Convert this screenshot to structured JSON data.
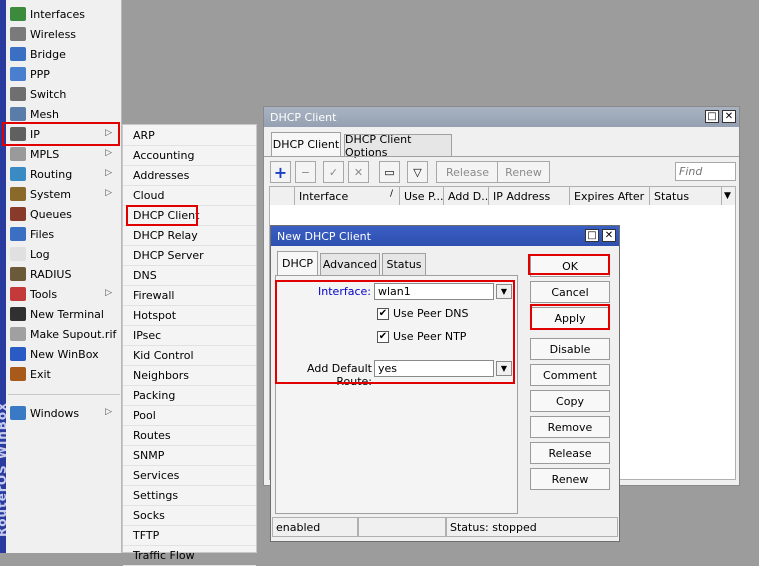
{
  "app": {
    "vertical_label": "RouterOS WinBox"
  },
  "main_menu": {
    "items": [
      {
        "label": "Interfaces",
        "icon": "interfaces-icon",
        "color": "#3c8a3c",
        "arrow": false
      },
      {
        "label": "Wireless",
        "icon": "wireless-icon",
        "color": "#7a7a7a",
        "arrow": false
      },
      {
        "label": "Bridge",
        "icon": "bridge-icon",
        "color": "#3a6fc4",
        "arrow": false
      },
      {
        "label": "PPP",
        "icon": "ppp-icon",
        "color": "#4a7fd0",
        "arrow": false
      },
      {
        "label": "Switch",
        "icon": "switch-icon",
        "color": "#6f6f6f",
        "arrow": false
      },
      {
        "label": "Mesh",
        "icon": "mesh-icon",
        "color": "#5a7ca8",
        "arrow": false
      },
      {
        "label": "IP",
        "icon": "ip-icon",
        "color": "#606060",
        "arrow": true
      },
      {
        "label": "MPLS",
        "icon": "mpls-icon",
        "color": "#9a9a9a",
        "arrow": true
      },
      {
        "label": "Routing",
        "icon": "routing-icon",
        "color": "#3a8ac4",
        "arrow": true
      },
      {
        "label": "System",
        "icon": "system-icon",
        "color": "#8a6a2a",
        "arrow": true
      },
      {
        "label": "Queues",
        "icon": "queues-icon",
        "color": "#8a3a2a",
        "arrow": false
      },
      {
        "label": "Files",
        "icon": "files-icon",
        "color": "#3a6fc4",
        "arrow": false
      },
      {
        "label": "Log",
        "icon": "log-icon",
        "color": "#e0e0e0",
        "arrow": false
      },
      {
        "label": "RADIUS",
        "icon": "radius-icon",
        "color": "#6a5a3a",
        "arrow": false
      },
      {
        "label": "Tools",
        "icon": "tools-icon",
        "color": "#c43a3a",
        "arrow": true
      },
      {
        "label": "New Terminal",
        "icon": "terminal-icon",
        "color": "#303030",
        "arrow": false
      },
      {
        "label": "Make Supout.rif",
        "icon": "supout-icon",
        "color": "#a0a0a0",
        "arrow": false
      },
      {
        "label": "New WinBox",
        "icon": "winbox-icon",
        "color": "#2a5ac4",
        "arrow": false
      },
      {
        "label": "Exit",
        "icon": "exit-icon",
        "color": "#a85a1a",
        "arrow": false
      }
    ],
    "windows_label": "Windows",
    "windows_icon": "windows-icon"
  },
  "ip_submenu": [
    "ARP",
    "Accounting",
    "Addresses",
    "Cloud",
    "DHCP Client",
    "DHCP Relay",
    "DHCP Server",
    "DNS",
    "Firewall",
    "Hotspot",
    "IPsec",
    "Kid Control",
    "Neighbors",
    "Packing",
    "Pool",
    "Routes",
    "SNMP",
    "Services",
    "Settings",
    "Socks",
    "TFTP",
    "Traffic Flow"
  ],
  "dhcp_window": {
    "title": "DHCP Client",
    "tabs": [
      "DHCP Client",
      "DHCP Client Options"
    ],
    "toolbar": {
      "release": "Release",
      "renew": "Renew",
      "find_placeholder": "Find"
    },
    "columns": [
      "",
      "Interface",
      "Use P...",
      "Add D...",
      "IP Address",
      "Expires After",
      "Status"
    ]
  },
  "new_dialog": {
    "title": "New DHCP Client",
    "tabs": [
      "DHCP",
      "Advanced",
      "Status"
    ],
    "interface_label": "Interface:",
    "interface_value": "wlan1",
    "use_peer_dns": "Use Peer DNS",
    "use_peer_ntp": "Use Peer NTP",
    "default_route_label": "Add Default Route:",
    "default_route_value": "yes",
    "buttons": [
      "OK",
      "Cancel",
      "Apply",
      "Disable",
      "Comment",
      "Copy",
      "Remove",
      "Release",
      "Renew"
    ],
    "status_bar": [
      "enabled",
      "",
      "Status: stopped"
    ]
  },
  "colors": {
    "highlight_red": "#e00000",
    "label_blue": "#0000cc",
    "title_active": "#2d4fb0"
  }
}
